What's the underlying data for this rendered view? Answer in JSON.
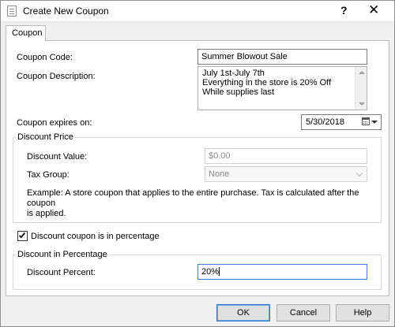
{
  "window": {
    "title": "Create New Coupon",
    "help_glyph": "?",
    "close_glyph": "✕"
  },
  "tabs": [
    {
      "label": "Coupon",
      "selected": true
    }
  ],
  "form": {
    "code_label": "Coupon Code:",
    "code_value": "Summer Blowout Sale",
    "description_label": "Coupon Description:",
    "description_lines": [
      "July 1st-July 7th",
      "Everything in the store is 20% Off",
      "While supplies last"
    ],
    "expires_label": "Coupon expires on:",
    "expires_value": "5/30/2018"
  },
  "discount_price": {
    "title": "Discount Price",
    "value_label": "Discount Value:",
    "value_placeholder": "$0.00",
    "tax_label": "Tax Group:",
    "tax_value": "None",
    "note_lines": [
      "Example: A store coupon that applies to the entire purchase.  Tax is calculated after the coupon",
      "is applied."
    ]
  },
  "percentage": {
    "checkbox_label": "Discount coupon is in percentage",
    "checked": true,
    "title": "Discount in Percentage",
    "percent_label": "Discount Percent:",
    "percent_value": "20%"
  },
  "buttons": {
    "ok": "OK",
    "cancel": "Cancel",
    "help": "Help"
  },
  "icons": {
    "app": "coupon-form-icon",
    "help": "help-icon",
    "close": "close-icon",
    "calendar": "calendar-icon",
    "dropdown": "chevron-down-icon"
  },
  "colors": {
    "window_bg": "#f0f0f0",
    "focus_border": "#3d7bd9",
    "default_button_border": "#2f7ad7"
  }
}
